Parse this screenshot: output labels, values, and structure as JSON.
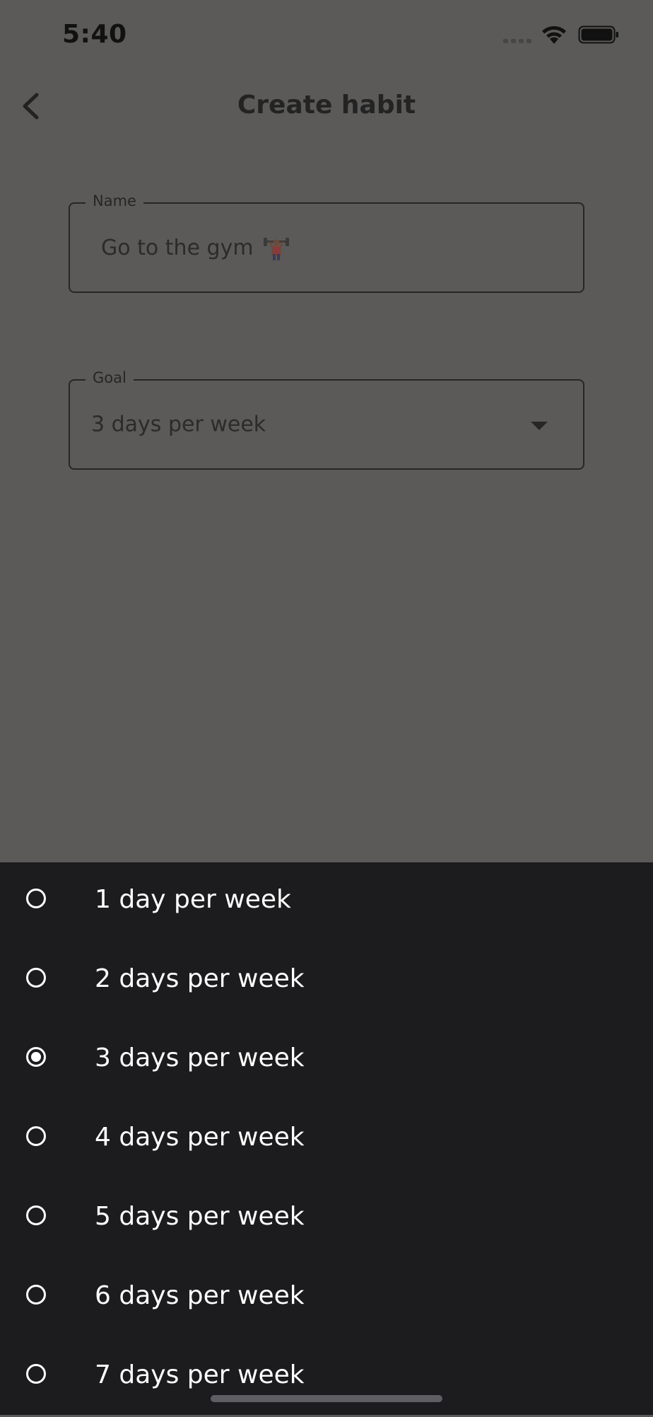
{
  "status_bar": {
    "time": "5:40"
  },
  "header": {
    "title": "Create habit"
  },
  "form": {
    "name_label": "Name",
    "name_value": "Go to the gym",
    "goal_label": "Goal",
    "goal_value": "3 days per week"
  },
  "options": {
    "items": [
      {
        "label": "1 day per week",
        "selected": false
      },
      {
        "label": "2 days per week",
        "selected": false
      },
      {
        "label": "3 days per week",
        "selected": true
      },
      {
        "label": "4 days per week",
        "selected": false
      },
      {
        "label": "5 days per week",
        "selected": false
      },
      {
        "label": "6 days per week",
        "selected": false
      },
      {
        "label": "7 days per week",
        "selected": false
      }
    ]
  },
  "colors": {
    "overlay_background": "#5b5a59",
    "sheet_background": "#1c1c1e",
    "option_text": "#ffffff"
  },
  "icons": {
    "back": "chevron-left-icon",
    "dropdown": "caret-down-icon",
    "name_emoji": "weight-lifter-emoji"
  }
}
